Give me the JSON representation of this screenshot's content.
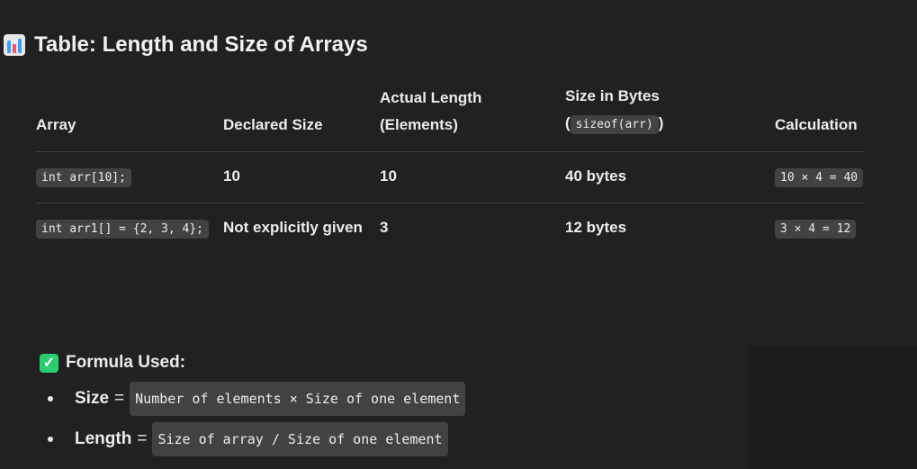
{
  "title": "Table: Length and Size of Arrays",
  "icons": {
    "title_icon": "bar-chart-icon",
    "formula_icon": "check-mark-icon"
  },
  "table": {
    "headers": [
      [
        "Array"
      ],
      [
        "Declared Size"
      ],
      [
        "Actual Length",
        "(Elements)"
      ],
      [
        "Size in Bytes",
        "(",
        "sizeof(arr)",
        ")"
      ],
      [
        "Calculation"
      ]
    ],
    "rows": [
      {
        "array": "int arr[10];",
        "declared": "10",
        "length": "10",
        "bytes": "40 bytes",
        "calc": "10 × 4 = 40"
      },
      {
        "array": "int arr1[] = {2, 3, 4};",
        "declared": "Not explicitly given",
        "length": "3",
        "bytes": "12 bytes",
        "calc": "3 × 4 = 12"
      }
    ]
  },
  "formula": {
    "heading": "Formula Used:",
    "items": [
      {
        "label": "Size",
        "eq": "=",
        "code": "Number of elements × Size of one element"
      },
      {
        "label": "Length",
        "eq": "=",
        "code": "Size of array / Size of one element"
      }
    ]
  },
  "colors": {
    "background": "#212121",
    "code_bg": "#424242",
    "check": "#2ecc71"
  }
}
